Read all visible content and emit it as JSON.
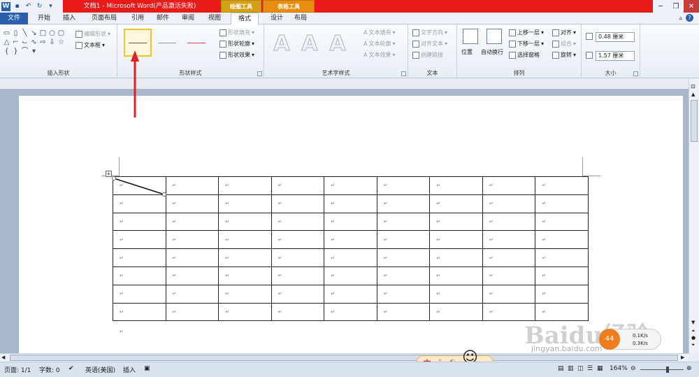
{
  "window": {
    "title": "文档1 - Microsoft Word(产品激活失败)"
  },
  "context_tabs": {
    "drawing_tools": "绘图工具",
    "table_tools": "表格工具"
  },
  "tabs": [
    {
      "label": "文件"
    },
    {
      "label": "开始"
    },
    {
      "label": "插入"
    },
    {
      "label": "页面布局"
    },
    {
      "label": "引用"
    },
    {
      "label": "邮件"
    },
    {
      "label": "审阅"
    },
    {
      "label": "视图"
    },
    {
      "label": "格式"
    },
    {
      "label": "设计"
    },
    {
      "label": "布局"
    }
  ],
  "ribbon": {
    "insert_shapes": {
      "label": "插入形状",
      "edit_shape": "编辑形状",
      "text_box": "文本框"
    },
    "shape_styles": {
      "label": "形状样式",
      "fill": "形状填充",
      "outline": "形状轮廓",
      "effects": "形状效果"
    },
    "art_styles": {
      "label": "艺术字样式",
      "text_fill": "文本填充",
      "text_outline": "文本轮廓",
      "text_effects": "文本效果",
      "sample": "A"
    },
    "text": {
      "label": "文本",
      "direction": "文字方向",
      "align": "对齐文本",
      "create_link": "创建链接"
    },
    "arrange": {
      "label": "排列",
      "position": "位置",
      "wrap": "自动换行",
      "bring_forward": "上移一层",
      "send_backward": "下移一层",
      "selection_pane": "选择窗格",
      "align": "对齐",
      "group": "组合",
      "rotate": "旋转"
    },
    "size": {
      "label": "大小",
      "height": "0.48 厘米",
      "width": "1.57 厘米"
    }
  },
  "document": {
    "para_mark": "↵",
    "rows": 8,
    "cols": 9
  },
  "status": {
    "page": "页面: 1/1",
    "words": "字数: 0",
    "language": "英语(美国)",
    "mode": "插入",
    "zoom": "164%"
  },
  "overlay": {
    "ime": "中",
    "watermark": "Baidu经验",
    "watermark_url": "jingyan.baidu.com",
    "speed_pct": "44",
    "speed_up": "0.1K/s",
    "speed_down": "0.3K/s"
  }
}
